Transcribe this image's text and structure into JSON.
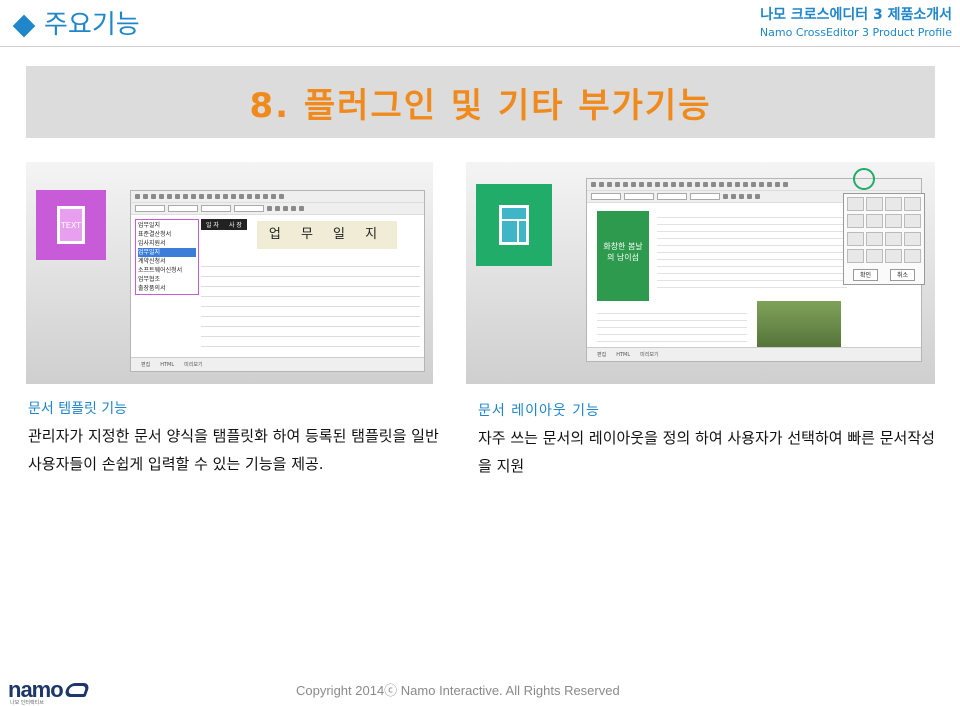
{
  "header": {
    "section_title": "주요기능",
    "product_kr": "나모 크로스에디터 3 제품소개서",
    "product_en": "Namo CrossEditor 3 Product Profile"
  },
  "banner": {
    "title": "8. 플러그인 및 기타 부가기능"
  },
  "panels": [
    {
      "icon_label": "TEXT",
      "template_list": [
        "업무일지",
        "표준결산청서",
        "입사지원서",
        "업무일지",
        "계약신청서",
        "소프트웨어신청서",
        "업무협조",
        "출장품의서"
      ],
      "template_headers": [
        "일 자",
        "사 장"
      ],
      "doc_title": "업 무 일 지",
      "caption": "문서 템플릿 기능",
      "description": "관리자가 지정한 문서 양식을 탬플릿화 하여 등록된 탬플릿을 일반 사용자들이 손쉽게 입력할 수 있는 기능을 제공."
    },
    {
      "green_text": "화창한 봄날의 남이섬",
      "popup_buttons": [
        "확인",
        "취소"
      ],
      "caption": "문서  레이아웃  기능",
      "description": "자주 쓰는 문서의 레이아웃을 정의 하여 사용자가 선택하여 빠른 문서작성을 지원"
    }
  ],
  "editor_tabs": [
    "편집",
    "HTML",
    "미리보기"
  ],
  "footer": {
    "logo_text": "namo",
    "logo_sub": "나모 인터랙티브",
    "copyright": "Copyright 2014ⓒ Namo Interactive. All Rights Reserved"
  },
  "colors": {
    "accent": "#1f86c9",
    "banner_text": "#f08a1c",
    "template_icon": "#c85bd7",
    "layout_icon": "#22ac6a",
    "logo": "#1c3768"
  }
}
